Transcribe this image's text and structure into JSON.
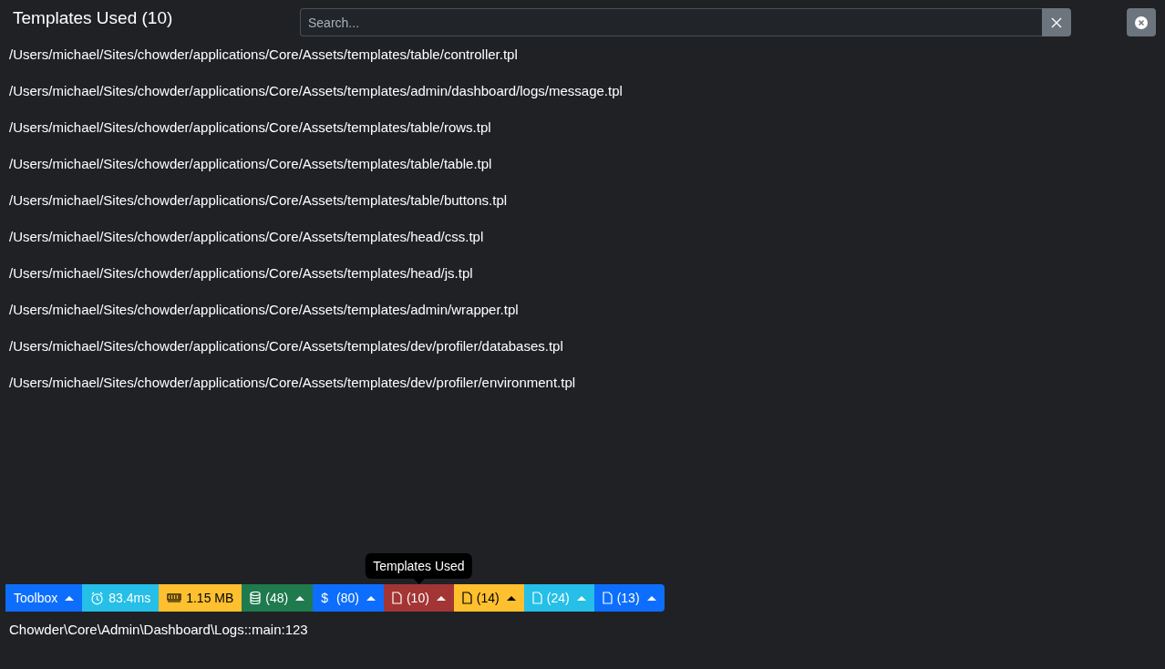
{
  "panel": {
    "title": "Templates Used (10)",
    "search": {
      "placeholder": "Search..."
    }
  },
  "templates": [
    "/Users/michael/Sites/chowder/applications/Core/Assets/templates/table/controller.tpl",
    "/Users/michael/Sites/chowder/applications/Core/Assets/templates/admin/dashboard/logs/message.tpl",
    "/Users/michael/Sites/chowder/applications/Core/Assets/templates/table/rows.tpl",
    "/Users/michael/Sites/chowder/applications/Core/Assets/templates/table/table.tpl",
    "/Users/michael/Sites/chowder/applications/Core/Assets/templates/table/buttons.tpl",
    "/Users/michael/Sites/chowder/applications/Core/Assets/templates/head/css.tpl",
    "/Users/michael/Sites/chowder/applications/Core/Assets/templates/head/js.tpl",
    "/Users/michael/Sites/chowder/applications/Core/Assets/templates/admin/wrapper.tpl",
    "/Users/michael/Sites/chowder/applications/Core/Assets/templates/dev/profiler/databases.tpl",
    "/Users/michael/Sites/chowder/applications/Core/Assets/templates/dev/profiler/environment.tpl"
  ],
  "toolbar": [
    {
      "kind": "toolbox",
      "label": "Toolbox",
      "color": "#0d6efd",
      "caret": true
    },
    {
      "kind": "timer",
      "label": "83.4ms",
      "color": "#25bfe7",
      "caret": false
    },
    {
      "kind": "memory",
      "label": "1.15 MB",
      "color": "#ffc02f",
      "caret": false
    },
    {
      "kind": "database",
      "label": "(48)",
      "color": "#1f7a4e",
      "caret": true
    },
    {
      "kind": "dollar",
      "label": "(80)",
      "color": "#0d6efd",
      "caret": true,
      "symbol": "$"
    },
    {
      "kind": "file",
      "label": "(10)",
      "color": "#a33535",
      "caret": true,
      "tooltip": "Templates Used"
    },
    {
      "kind": "file",
      "label": "(14)",
      "color": "#ffc02f",
      "caret": true
    },
    {
      "kind": "file",
      "label": "(24)",
      "color": "#25bfe7",
      "caret": true
    },
    {
      "kind": "file",
      "label": "(13)",
      "color": "#0d6efd",
      "caret": true
    }
  ],
  "route": "Chowder\\Core\\Admin\\Dashboard\\Logs::main:123"
}
